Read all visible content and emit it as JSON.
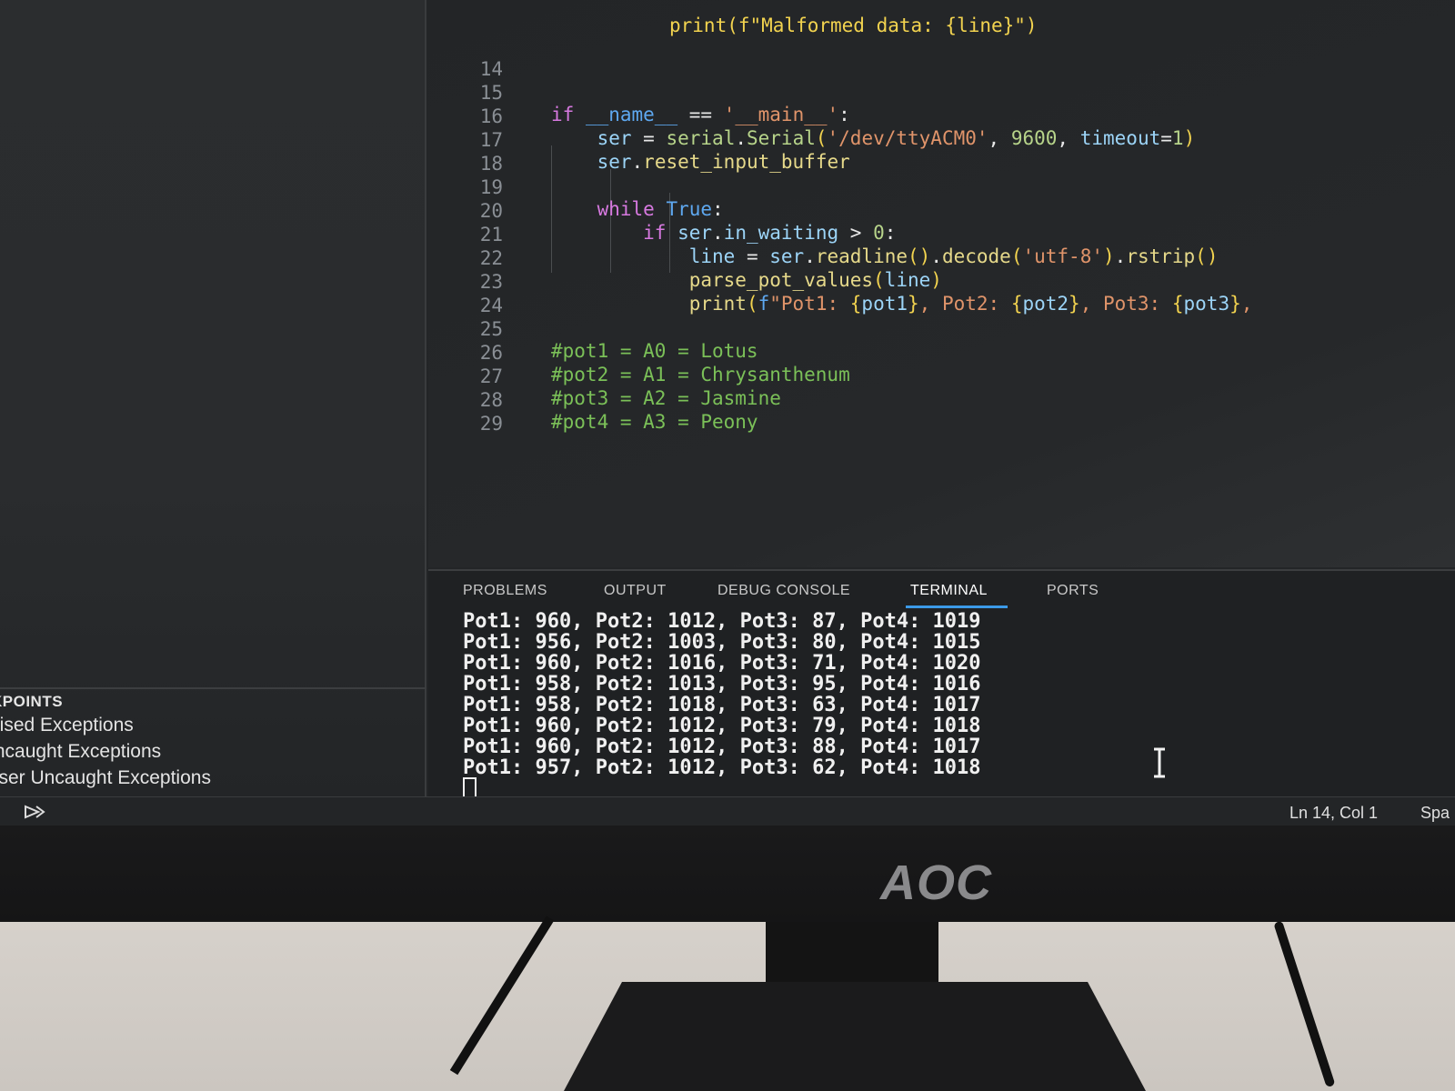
{
  "editor": {
    "top_partial": "print(f\"Malformed data: {line}\")",
    "lines": [
      {
        "n": "14",
        "code": ""
      },
      {
        "n": "15",
        "code": "if __name__ == '__main__':"
      },
      {
        "n": "16",
        "code": "    ser = serial.Serial('/dev/ttyACM0', 9600, timeout=1)"
      },
      {
        "n": "17",
        "code": "    ser.reset_input_buffer"
      },
      {
        "n": "18",
        "code": ""
      },
      {
        "n": "19",
        "code": "    while True:"
      },
      {
        "n": "20",
        "code": "        if ser.in_waiting > 0:"
      },
      {
        "n": "21",
        "code": "            line = ser.readline().decode('utf-8').rstrip()"
      },
      {
        "n": "22",
        "code": "            parse_pot_values(line)"
      },
      {
        "n": "23",
        "code": "            print(f\"Pot1: {pot1}, Pot2: {pot2}, Pot3: {pot3},"
      },
      {
        "n": "24",
        "code": ""
      },
      {
        "n": "25",
        "code": "#pot1 = A0 = Lotus"
      },
      {
        "n": "26",
        "code": "#pot2 = A1 = Chrysanthenum"
      },
      {
        "n": "27",
        "code": "#pot3 = A2 = Jasmine"
      },
      {
        "n": "28",
        "code": "#pot4 = A3 = Peony"
      },
      {
        "n": "29",
        "code": ""
      }
    ]
  },
  "panel": {
    "tabs": [
      "PROBLEMS",
      "OUTPUT",
      "DEBUG CONSOLE",
      "TERMINAL",
      "PORTS"
    ],
    "active_tab": "TERMINAL",
    "terminal_lines": [
      "Pot1: 960, Pot2: 1012, Pot3: 87, Pot4: 1019",
      "Pot1: 956, Pot2: 1003, Pot3: 80, Pot4: 1015",
      "Pot1: 960, Pot2: 1016, Pot3: 71, Pot4: 1020",
      "Pot1: 958, Pot2: 1013, Pot3: 95, Pot4: 1016",
      "Pot1: 958, Pot2: 1018, Pot3: 63, Pot4: 1017",
      "Pot1: 960, Pot2: 1012, Pot3: 79, Pot4: 1018",
      "Pot1: 960, Pot2: 1012, Pot3: 88, Pot4: 1017",
      "Pot1: 957, Pot2: 1012, Pot3: 62, Pot4: 1018"
    ]
  },
  "sidebar": {
    "breakpoints_title": "KPOINTS",
    "items": [
      "aised Exceptions",
      "Incaught Exceptions",
      "Jser Uncaught Exceptions"
    ]
  },
  "statusbar": {
    "position": "Ln 14, Col 1",
    "spaces": "Spa"
  },
  "monitor": {
    "brand": "AOC"
  },
  "icons": {
    "status_left": "debug-run-icon",
    "mouse_cursor": "text-cursor-icon"
  },
  "colors": {
    "keyword": "#d779e0",
    "comment": "#7bc058",
    "string": "#e0946a",
    "accent": "#3b9ae8"
  }
}
